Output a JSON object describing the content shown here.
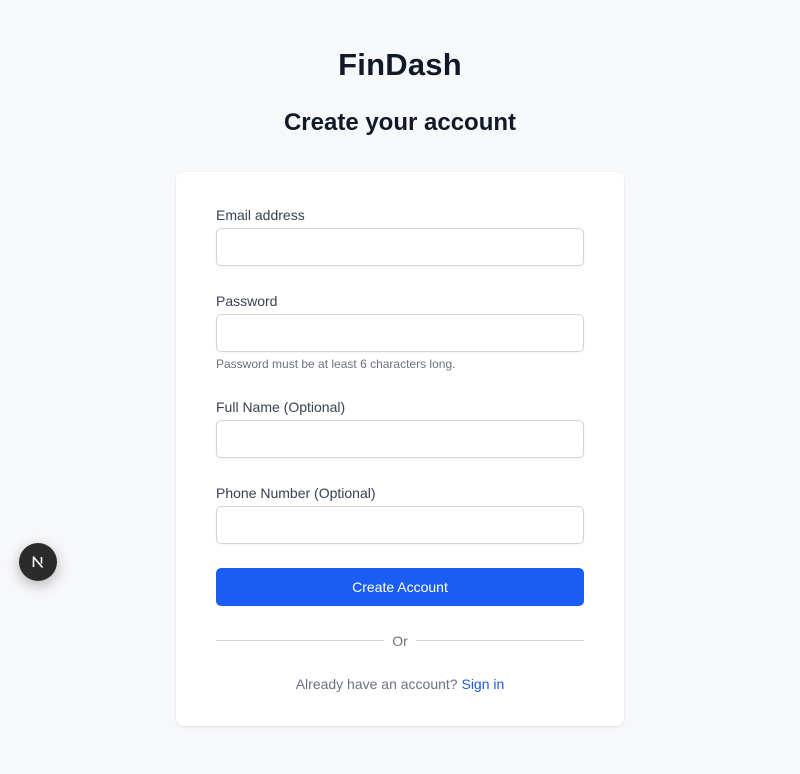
{
  "app": {
    "brand": "FinDash",
    "heading": "Create your account"
  },
  "form": {
    "email": {
      "label": "Email address",
      "value": "",
      "placeholder": ""
    },
    "password": {
      "label": "Password",
      "value": "",
      "placeholder": "",
      "hint": "Password must be at least 6 characters long."
    },
    "full_name": {
      "label": "Full Name (Optional)",
      "value": "",
      "placeholder": ""
    },
    "phone": {
      "label": "Phone Number (Optional)",
      "value": "",
      "placeholder": ""
    },
    "submit_label": "Create Account",
    "divider_text": "Or",
    "signin_prompt": "Already have an account?",
    "signin_link": "Sign in"
  },
  "dev_badge": {
    "icon": "nextjs-logo-icon"
  },
  "colors": {
    "background": "#f7f8fa",
    "primary_button": "#1b5cf5",
    "link": "#1d5bd6",
    "badge": "#2b2b2b"
  }
}
